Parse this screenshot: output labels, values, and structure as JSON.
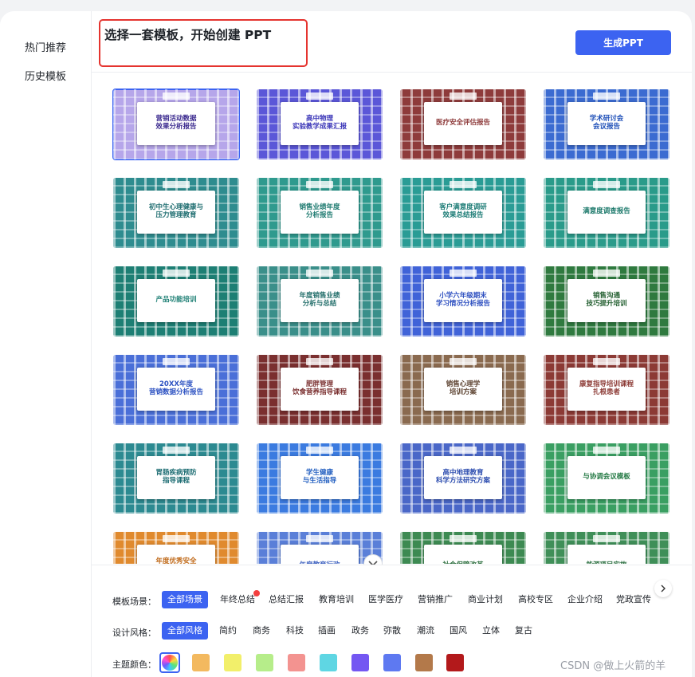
{
  "sidebar": {
    "items": [
      {
        "label": "热门推荐"
      },
      {
        "label": "历史模板"
      }
    ]
  },
  "header": {
    "title": "选择一套模板，开始创建 PPT",
    "generate_button": "生成PPT"
  },
  "templates": [
    {
      "title": "营销活动数据\n效果分析报告",
      "color": "#b6a6ea",
      "text_color": "#3b2a8f"
    },
    {
      "title": "高中物理\n实验教学成果汇报",
      "color": "#5b57d8",
      "text_color": "#3b36b8"
    },
    {
      "title": "医疗安全评估报告",
      "color": "#8e3b3b",
      "text_color": "#8e3b3b"
    },
    {
      "title": "学术研讨会\n会议报告",
      "color": "#3b6bd1",
      "text_color": "#1e4fb8"
    },
    {
      "title": "初中生心理健康与\n压力管理教育",
      "color": "#2e8c8f",
      "text_color": "#1e6d70"
    },
    {
      "title": "销售业绩年度\n分析报告",
      "color": "#2f9a8e",
      "text_color": "#1e7a70"
    },
    {
      "title": "客户满意度调研\n效果总结报告",
      "color": "#2a9c95",
      "text_color": "#1d7c76"
    },
    {
      "title": "满意度调查报告",
      "color": "#2a9b8a",
      "text_color": "#1e7a6c"
    },
    {
      "title": "产品功能培训",
      "color": "#1d7f74",
      "text_color": "#1d7f74"
    },
    {
      "title": "年度销售业绩\n分析与总结",
      "color": "#3a8f8a",
      "text_color": "#216d69"
    },
    {
      "title": "小学六年级期末\n学习情况分析报告",
      "color": "#4063d8",
      "text_color": "#2d4fc0"
    },
    {
      "title": "销售沟通\n技巧提升培训",
      "color": "#2f7a3f",
      "text_color": "#235f30"
    },
    {
      "title": "20XX年度\n营销数据分析报告",
      "color": "#4a6fd8",
      "text_color": "#2d52c2"
    },
    {
      "title": "肥胖管理\n饮食营养指导课程",
      "color": "#7a2f2f",
      "text_color": "#7a2f2f"
    },
    {
      "title": "销售心理学\n培训方案",
      "color": "#8a6a4f",
      "text_color": "#5d4331"
    },
    {
      "title": "康复指导培训课程\n扎根患者",
      "color": "#8c3a35",
      "text_color": "#8c3a35"
    },
    {
      "title": "胃肠疾病预防\n指导课程",
      "color": "#2c8a91",
      "text_color": "#1d6d73"
    },
    {
      "title": "学生健康\n与生活指导",
      "color": "#3b7be0",
      "text_color": "#235fc0"
    },
    {
      "title": "高中地理教育\n科学方法研究方案",
      "color": "#4a67c8",
      "text_color": "#2f4fb0"
    },
    {
      "title": "与协调会议模板",
      "color": "#3a9f62",
      "text_color": "#257a45"
    },
    {
      "title": "年度优秀安全\n工作总结",
      "color": "#e08a2e",
      "text_color": "#c06a1a"
    },
    {
      "title": "年度教育行政",
      "color": "#5a7fd8",
      "text_color": "#3b5fbf"
    },
    {
      "title": "社会保障改革",
      "color": "#3d8a52",
      "text_color": "#2a6d3c"
    },
    {
      "title": "能源项目实施",
      "color": "#3f8f58",
      "text_color": "#2b6f40"
    }
  ],
  "filters": {
    "scene": {
      "label": "模板场景：",
      "options": [
        "全部场景",
        "年终总结",
        "总结汇报",
        "教育培训",
        "医学医疗",
        "营销推广",
        "商业计划",
        "高校专区",
        "企业介绍",
        "党政宣传"
      ]
    },
    "style": {
      "label": "设计风格：",
      "options": [
        "全部风格",
        "简约",
        "商务",
        "科技",
        "插画",
        "政务",
        "弥散",
        "潮流",
        "国风",
        "立体",
        "复古"
      ]
    },
    "color": {
      "label": "主题颜色：",
      "swatches": [
        "rainbow",
        "#f3b95f",
        "#f2ef6a",
        "#b6ed8a",
        "#f39390",
        "#5fd6e3",
        "#7457f2",
        "#5e79f1",
        "#b3794a",
        "#b3191b"
      ]
    }
  },
  "watermark": "CSDN @做上火箭的羊"
}
